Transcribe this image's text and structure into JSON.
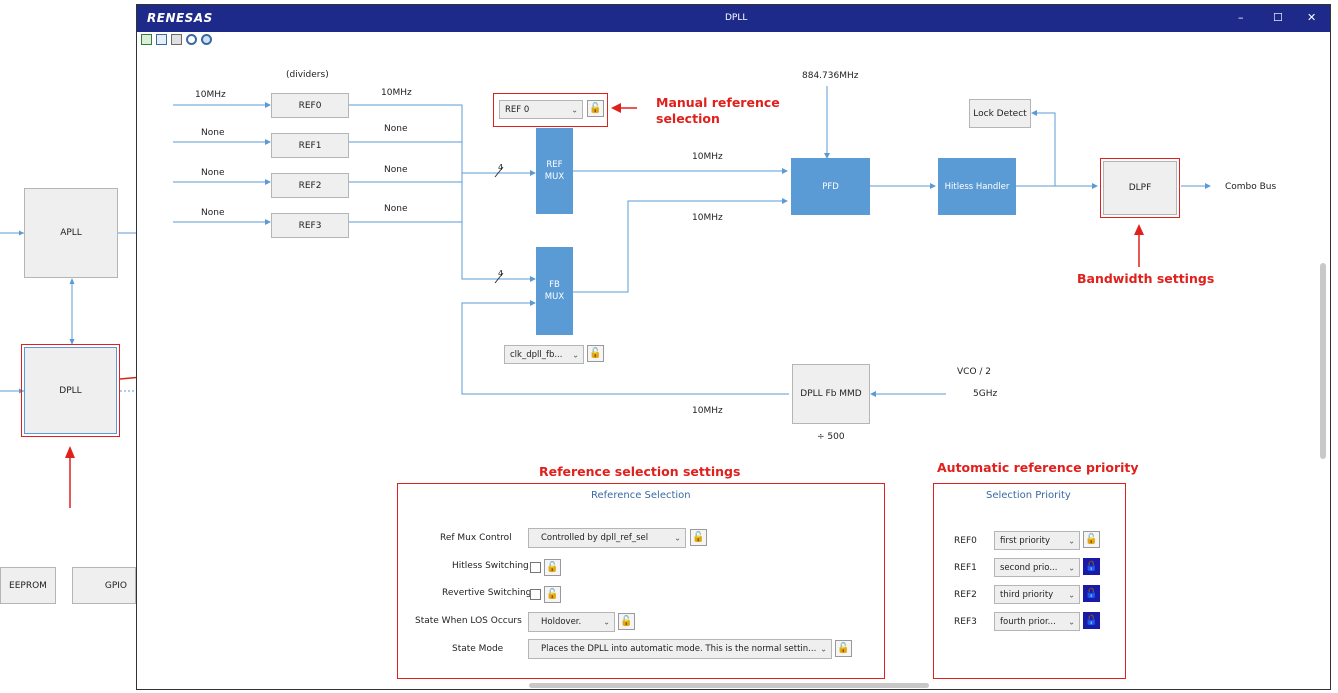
{
  "bg": {
    "apll": "APLL",
    "dpll": "DPLL",
    "eeprom": "EEPROM",
    "gpio": "GPIO"
  },
  "window": {
    "brand": "RENESAS",
    "title": "DPLL",
    "min": "–",
    "max": "☐",
    "close": "✕"
  },
  "toolbar": {
    "icons": [
      "fit-icon",
      "expand-icon",
      "print-icon",
      "zoom-out-icon",
      "zoom-in-icon"
    ]
  },
  "diagram": {
    "dividers": "(dividers)",
    "refs": [
      {
        "in": "10MHz",
        "name": "REF0",
        "out": "10MHz"
      },
      {
        "in": "None",
        "name": "REF1",
        "out": "None"
      },
      {
        "in": "None",
        "name": "REF2",
        "out": "None"
      },
      {
        "in": "None",
        "name": "REF3",
        "out": "None"
      }
    ],
    "ref_select": "REF 0",
    "ref_mux": "REF\nMUX",
    "fb_mux": "FB\nMUX",
    "bus_width": "4",
    "fb_select": "clk_dpll_fb...",
    "pfd": "PFD",
    "pfd_in": "884.736MHz",
    "ref_freq": "10MHz",
    "fb_freq": "10MHz",
    "hitless": "Hitless Handler",
    "lock": "Lock Detect",
    "dlpf": "DLPF",
    "combo": "Combo Bus",
    "mmd": "DPLL Fb MMD",
    "div": "÷ 500",
    "vco": "VCO / 2",
    "vco_freq": "5GHz",
    "fb_out": "10MHz"
  },
  "annotations": {
    "manual": "Manual reference selection",
    "bandwidth": "Bandwidth settings",
    "refsel": "Reference selection settings",
    "auto": "Automatic reference priority"
  },
  "ref_panel": {
    "title": "Reference Selection",
    "mux_label": "Ref Mux Control",
    "mux_value": "Controlled by dpll_ref_sel",
    "hitless_label": "Hitless Switching",
    "revertive_label": "Revertive Switching",
    "los_label": "State When LOS Occurs",
    "los_value": "Holdover.",
    "mode_label": "State Mode",
    "mode_value": "Places the DPLL into automatic mode. This is the normal settin..."
  },
  "prio_panel": {
    "title": "Selection Priority",
    "rows": [
      {
        "ref": "REF0",
        "value": "first priority"
      },
      {
        "ref": "REF1",
        "value": "second prio..."
      },
      {
        "ref": "REF2",
        "value": "third priority"
      },
      {
        "ref": "REF3",
        "value": "fourth prior..."
      }
    ]
  },
  "colors": {
    "block": "#5b9bd5",
    "titlebar": "#1d2a8a",
    "annotation": "#e0201c",
    "wire": "#5b9bd5"
  }
}
